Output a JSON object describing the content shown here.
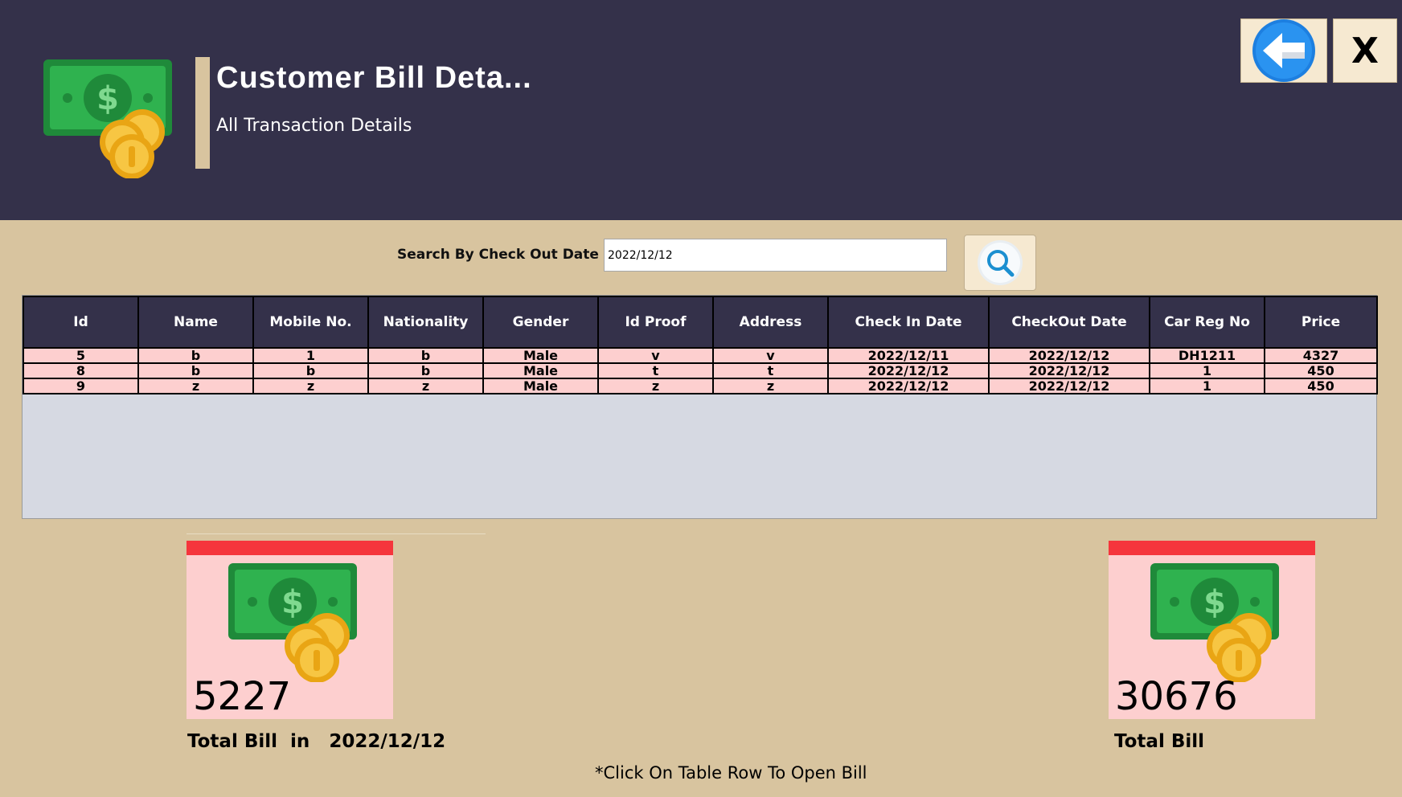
{
  "header": {
    "title": "Customer Bill Deta...",
    "subtitle": "All Transaction Details",
    "logo_icon": "money-coins-icon",
    "back_icon": "arrow-left-icon",
    "close_label": "X"
  },
  "search": {
    "label": "Search By Check Out Date",
    "value": "2022/12/12",
    "button_icon": "search-icon"
  },
  "table": {
    "columns": [
      "Id",
      "Name",
      "Mobile No.",
      "Nationality",
      "Gender",
      "Id Proof",
      "Address",
      "Check In Date",
      "CheckOut Date",
      "Car Reg No",
      "Price"
    ],
    "rows": [
      [
        "5",
        "b",
        "1",
        "b",
        "Male",
        "v",
        "v",
        "2022/12/11",
        "2022/12/12",
        "DH1211",
        "4327"
      ],
      [
        "8",
        "b",
        "b",
        "b",
        "Male",
        "t",
        "t",
        "2022/12/12",
        "2022/12/12",
        "1",
        "450"
      ],
      [
        "9",
        "z",
        "z",
        "z",
        "Male",
        "z",
        "z",
        "2022/12/12",
        "2022/12/12",
        "1",
        "450"
      ]
    ]
  },
  "cards": {
    "date_total": {
      "value": "5227",
      "caption": "Total Bill  in   2022/12/12"
    },
    "grand_total": {
      "value": "30676",
      "caption": "Total Bill"
    }
  },
  "hint": "*Click On Table Row To Open Bill",
  "colors": {
    "header_bg": "#34314a",
    "page_bg": "#d8c49f",
    "row_bg": "#fdcfcf",
    "card_bar": "#f5353c",
    "money_green": "#27a745",
    "coin_gold": "#f7bd28"
  }
}
